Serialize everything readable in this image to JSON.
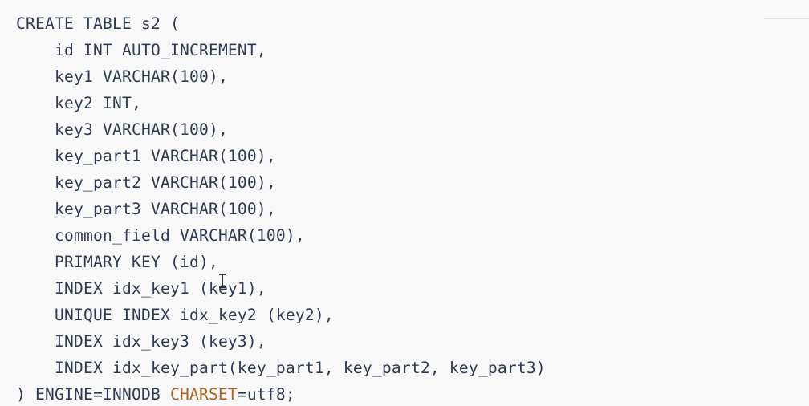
{
  "code_lines": {
    "l01": "CREATE TABLE s2 (",
    "l02": "id INT AUTO_INCREMENT,",
    "l03": "key1 VARCHAR(100),",
    "l04": "key2 INT,",
    "l05": "key3 VARCHAR(100),",
    "l06": "key_part1 VARCHAR(100),",
    "l07": "key_part2 VARCHAR(100),",
    "l08": "key_part3 VARCHAR(100),",
    "l09": "common_field VARCHAR(100),",
    "l10": "PRIMARY KEY (id),",
    "l11": "INDEX idx_key1 (key1),",
    "l12": "UNIQUE INDEX idx_key2 (key2),",
    "l13": "INDEX idx_key3 (key3),",
    "l14": "INDEX idx_key_part(key_part1, key_part2, key_part3)",
    "l15_prefix": ") ENGINE=INNODB ",
    "l15_keyword": "CHARSET",
    "l15_suffix": "=utf8;"
  },
  "colors": {
    "background": "#f8f8f8",
    "text": "#2f3b54",
    "charset_keyword": "#b0651f"
  },
  "icons": {
    "cursor": "text-cursor-icon"
  }
}
